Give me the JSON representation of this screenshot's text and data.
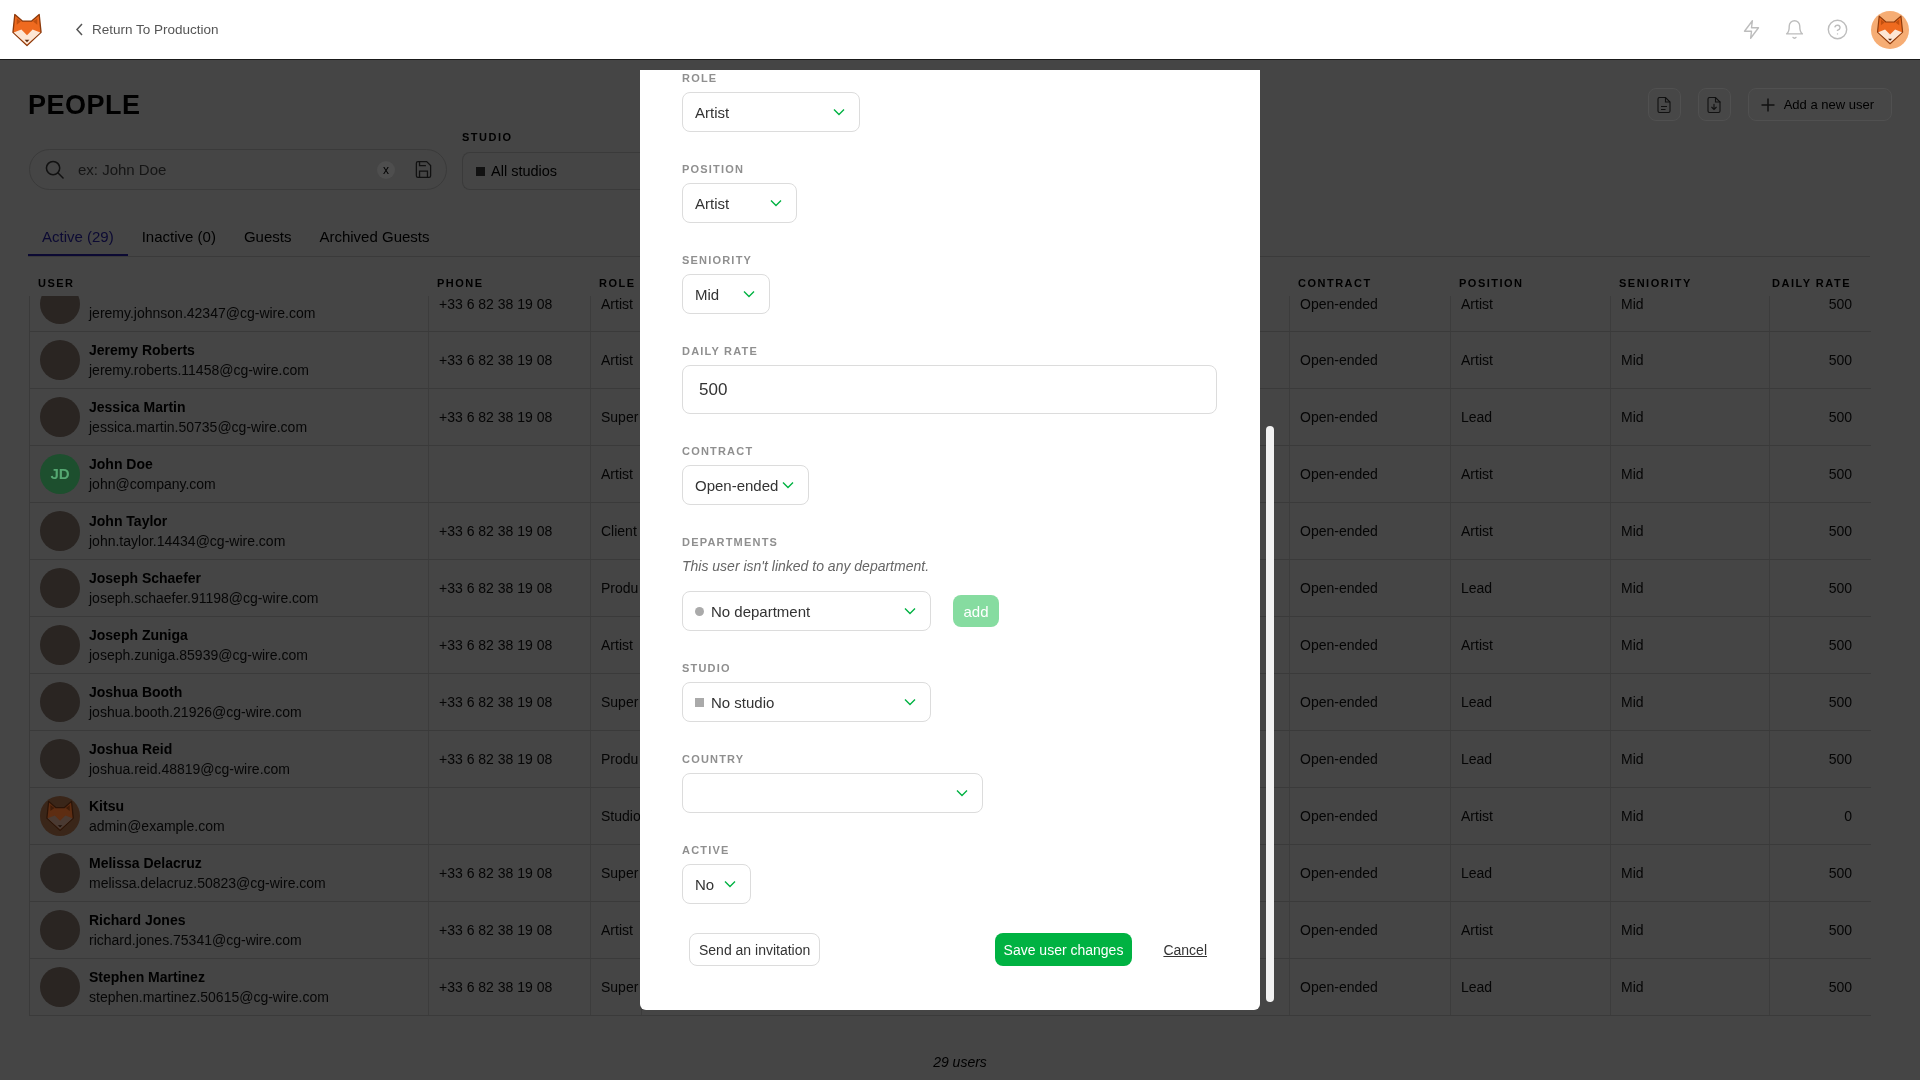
{
  "top_bar": {
    "back_link": "Return To Production"
  },
  "people": {
    "title": "PEOPLE",
    "add_user_button": "Add a new user",
    "search": {
      "placeholder": "ex: John Doe",
      "clear_button": "x"
    },
    "studio_filter": {
      "label": "STUDIO",
      "value": "All studios"
    },
    "tabs": [
      {
        "label": "Active (29)",
        "selected": true
      },
      {
        "label": "Inactive (0)",
        "selected": false
      },
      {
        "label": "Guests",
        "selected": false
      },
      {
        "label": "Archived Guests",
        "selected": false
      }
    ],
    "table": {
      "columns": [
        "USER",
        "PHONE",
        "ROLE",
        "CONTRACT",
        "POSITION",
        "SENIORITY",
        "DAILY RATE"
      ],
      "rows": [
        {
          "avatar": {
            "kind": "photo"
          },
          "email": "jeremy.johnson.42347@cg-wire.com",
          "phone": "+33 6 82 38 19 08",
          "role": "Artist",
          "contract": "Open-ended",
          "position": "Artist",
          "seniority": "Mid",
          "daily_rate": "500"
        },
        {
          "avatar": {
            "kind": "photo"
          },
          "name": "Jeremy Roberts",
          "email": "jeremy.roberts.11458@cg-wire.com",
          "phone": "+33 6 82 38 19 08",
          "role": "Artist",
          "contract": "Open-ended",
          "position": "Artist",
          "seniority": "Mid",
          "daily_rate": "500"
        },
        {
          "avatar": {
            "kind": "photo"
          },
          "name": "Jessica Martin",
          "email": "jessica.martin.50735@cg-wire.com",
          "phone": "+33 6 82 38 19 08",
          "role": "Super",
          "contract": "Open-ended",
          "position": "Lead",
          "seniority": "Mid",
          "daily_rate": "500"
        },
        {
          "avatar": {
            "kind": "initials",
            "initials": "JD"
          },
          "name": "John Doe",
          "email": "john@company.com",
          "role": "Artist",
          "contract": "Open-ended",
          "position": "Artist",
          "seniority": "Mid",
          "daily_rate": "500"
        },
        {
          "avatar": {
            "kind": "photo"
          },
          "name": "John Taylor",
          "email": "john.taylor.14434@cg-wire.com",
          "phone": "+33 6 82 38 19 08",
          "role": "Client",
          "contract": "Open-ended",
          "position": "Artist",
          "seniority": "Mid",
          "daily_rate": "500"
        },
        {
          "avatar": {
            "kind": "photo"
          },
          "name": "Joseph Schaefer",
          "email": "joseph.schaefer.91198@cg-wire.com",
          "phone": "+33 6 82 38 19 08",
          "role": "Produ",
          "contract": "Open-ended",
          "position": "Lead",
          "seniority": "Mid",
          "daily_rate": "500"
        },
        {
          "avatar": {
            "kind": "photo"
          },
          "name": "Joseph Zuniga",
          "email": "joseph.zuniga.85939@cg-wire.com",
          "phone": "+33 6 82 38 19 08",
          "role": "Artist",
          "contract": "Open-ended",
          "position": "Artist",
          "seniority": "Mid",
          "daily_rate": "500"
        },
        {
          "avatar": {
            "kind": "photo"
          },
          "name": "Joshua Booth",
          "email": "joshua.booth.21926@cg-wire.com",
          "phone": "+33 6 82 38 19 08",
          "role": "Super",
          "contract": "Open-ended",
          "position": "Lead",
          "seniority": "Mid",
          "daily_rate": "500"
        },
        {
          "avatar": {
            "kind": "photo"
          },
          "name": "Joshua Reid",
          "email": "joshua.reid.48819@cg-wire.com",
          "phone": "+33 6 82 38 19 08",
          "role": "Produ",
          "contract": "Open-ended",
          "position": "Lead",
          "seniority": "Mid",
          "daily_rate": "500"
        },
        {
          "avatar": {
            "kind": "logo"
          },
          "name": "Kitsu",
          "email": "admin@example.com",
          "role": "Studio",
          "contract": "Open-ended",
          "position": "Artist",
          "seniority": "Mid",
          "daily_rate": "0"
        },
        {
          "avatar": {
            "kind": "photo"
          },
          "name": "Melissa Delacruz",
          "email": "melissa.delacruz.50823@cg-wire.com",
          "phone": "+33 6 82 38 19 08",
          "role": "Super",
          "contract": "Open-ended",
          "position": "Lead",
          "seniority": "Mid",
          "daily_rate": "500"
        },
        {
          "avatar": {
            "kind": "photo"
          },
          "name": "Richard Jones",
          "email": "richard.jones.75341@cg-wire.com",
          "phone": "+33 6 82 38 19 08",
          "role": "Artist",
          "contract": "Open-ended",
          "position": "Artist",
          "seniority": "Mid",
          "daily_rate": "500"
        },
        {
          "avatar": {
            "kind": "photo"
          },
          "name": "Stephen Martinez",
          "email": "stephen.martinez.50615@cg-wire.com",
          "phone": "+33 6 82 38 19 08",
          "role": "Super",
          "contract": "Open-ended",
          "position": "Lead",
          "seniority": "Mid",
          "daily_rate": "500"
        }
      ]
    },
    "footer": "29 users"
  },
  "edit_user_dialog": {
    "fields": [
      {
        "kind": "select",
        "label": "ROLE",
        "value": "Artist"
      },
      {
        "kind": "select",
        "label": "POSITION",
        "value": "Artist"
      },
      {
        "kind": "select",
        "label": "SENIORITY",
        "value": "Mid"
      },
      {
        "kind": "input",
        "label": "DAILY RATE",
        "value": "500"
      },
      {
        "kind": "select",
        "label": "CONTRACT",
        "value": "Open-ended"
      },
      {
        "kind": "department_select",
        "label": "DEPARTMENTS",
        "note": "This user isn't linked to any department.",
        "value": "No department",
        "add_button": {
          "label": "add",
          "disabled": true
        }
      },
      {
        "kind": "studio_select",
        "label": "STUDIO",
        "value": "No studio"
      },
      {
        "kind": "select",
        "label": "COUNTRY"
      },
      {
        "kind": "select",
        "label": "ACTIVE",
        "value": "No"
      }
    ],
    "invite_button": "Send an invitation",
    "save_button": "Save user changes",
    "cancel_link": "Cancel"
  }
}
